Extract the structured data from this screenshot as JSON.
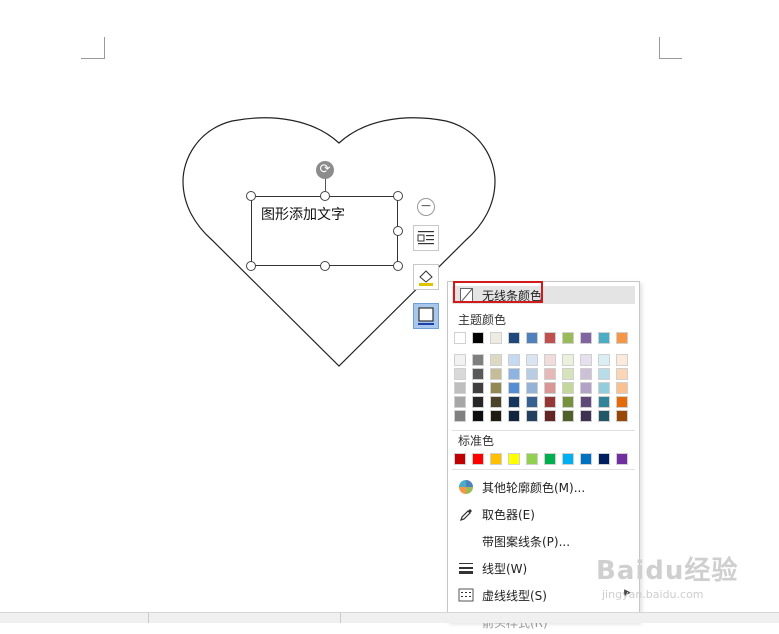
{
  "document": {
    "shape_text": "图形添加文字"
  },
  "side_toolbar": {
    "collapse_icon": "minus-circle-icon",
    "layout_icon": "wrap-text-icon",
    "fill_icon": "fill-bucket-icon",
    "outline_icon": "shape-outline-icon"
  },
  "outline_menu": {
    "no_line_label": "无线条颜色",
    "theme_colors_label": "主题颜色",
    "theme_colors_top": [
      "#ffffff",
      "#000000",
      "#eeece1",
      "#1f497d",
      "#4f81bd",
      "#c0504d",
      "#9bbb59",
      "#8064a2",
      "#4bacc6",
      "#f79646"
    ],
    "theme_color_columns": [
      [
        "#f2f2f2",
        "#d9d9d9",
        "#bfbfbf",
        "#a6a6a6",
        "#808080"
      ],
      [
        "#7f7f7f",
        "#595959",
        "#3f3f3f",
        "#262626",
        "#0d0d0d"
      ],
      [
        "#ddd9c3",
        "#c4bd97",
        "#938953",
        "#494429",
        "#1d1b10"
      ],
      [
        "#c6d9f0",
        "#8db3e2",
        "#548dd4",
        "#17365d",
        "#0f243e"
      ],
      [
        "#dbe5f1",
        "#b8cce4",
        "#95b3d7",
        "#366092",
        "#244061"
      ],
      [
        "#f2dcdb",
        "#e5b9b7",
        "#d99694",
        "#953734",
        "#632423"
      ],
      [
        "#ebf1dd",
        "#d7e3bc",
        "#c3d69b",
        "#76923c",
        "#4f6128"
      ],
      [
        "#e5e0ec",
        "#ccc1d9",
        "#b2a2c7",
        "#5f497a",
        "#3f3151"
      ],
      [
        "#dbeef3",
        "#b7dde8",
        "#92cddc",
        "#31859b",
        "#205867"
      ],
      [
        "#fdeada",
        "#fbd5b5",
        "#fac08f",
        "#e36c09",
        "#974806"
      ]
    ],
    "standard_colors_label": "标准色",
    "standard_colors": [
      "#c00000",
      "#ff0000",
      "#ffc000",
      "#ffff00",
      "#92d050",
      "#00b050",
      "#00b0f0",
      "#0070c0",
      "#002060",
      "#7030a0"
    ],
    "items": [
      {
        "label": "其他轮廓颜色(M)...",
        "icon": "color-wheel-icon"
      },
      {
        "label": "取色器(E)",
        "icon": "eyedropper-icon"
      },
      {
        "label": "带图案线条(P)...",
        "icon": ""
      },
      {
        "label": "线型(W)",
        "icon": "line-weight-icon"
      },
      {
        "label": "虚线线型(S)",
        "icon": "dash-type-icon"
      },
      {
        "label": "箭头样式(R)",
        "icon": "arrow-style-icon"
      }
    ]
  },
  "watermark": {
    "brand": "Baidu经验",
    "url": "jingyan.baidu.com"
  },
  "accent_colors": {
    "highlight_border": "#d11a1a",
    "active_button": "#a8c7ec"
  }
}
